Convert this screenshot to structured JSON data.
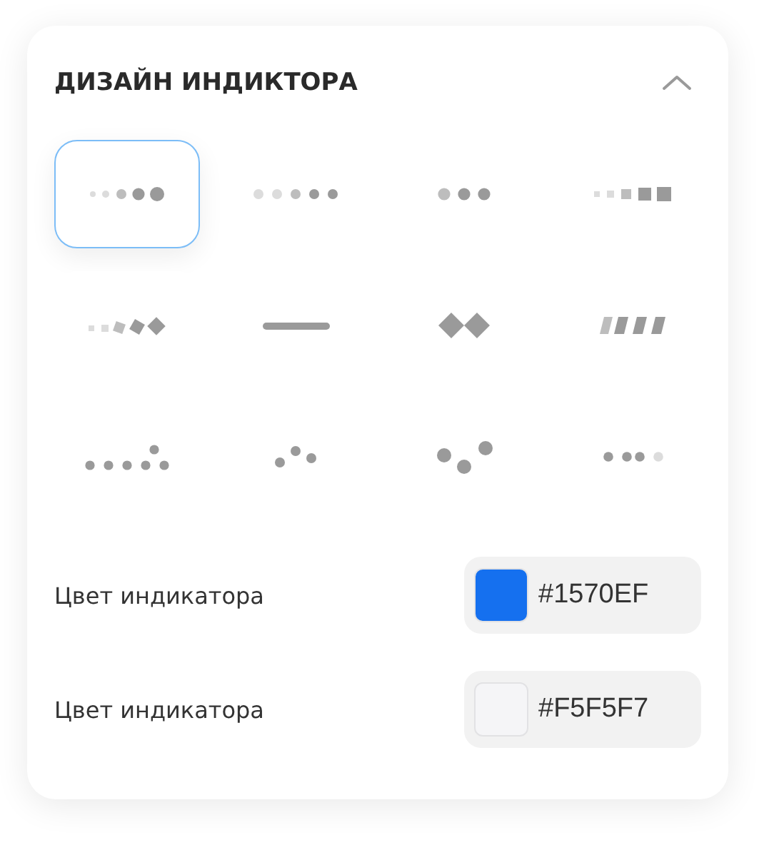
{
  "panel": {
    "title": "ДИЗАЙН ИНДИКТОРА",
    "expanded": true
  },
  "designs": [
    {
      "kind": "growing-dots",
      "selected": true
    },
    {
      "kind": "fading-dots",
      "selected": false
    },
    {
      "kind": "three-dots",
      "selected": false
    },
    {
      "kind": "growing-squares",
      "selected": false
    },
    {
      "kind": "growing-diamonds",
      "selected": false
    },
    {
      "kind": "bar",
      "selected": false
    },
    {
      "kind": "two-diamonds",
      "selected": false
    },
    {
      "kind": "skewed-bars",
      "selected": false
    },
    {
      "kind": "dots-wave",
      "selected": false
    },
    {
      "kind": "three-scatter",
      "selected": false
    },
    {
      "kind": "three-bounce",
      "selected": false
    },
    {
      "kind": "dots-pairs",
      "selected": false
    }
  ],
  "colors": [
    {
      "label": "Цвет индикатора",
      "value": "#1570EF",
      "color": "#1570ef"
    },
    {
      "label": "Цвет индикатора",
      "value": "#F5F5F7",
      "color": "#f5f5f7"
    }
  ]
}
